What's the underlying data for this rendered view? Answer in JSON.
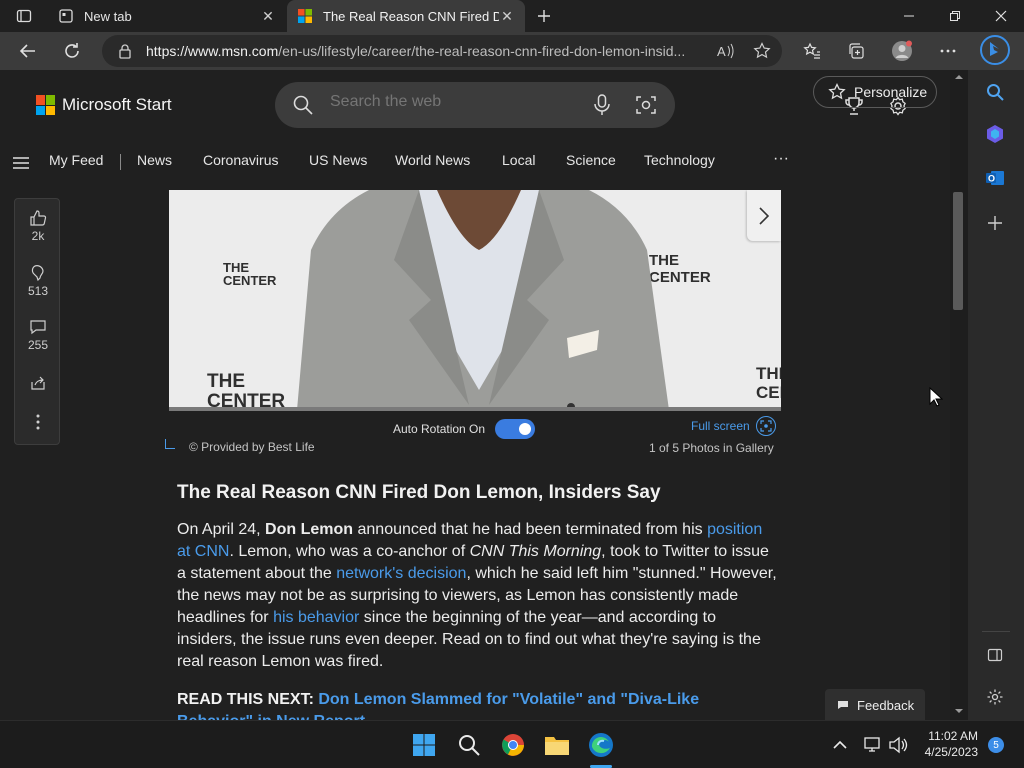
{
  "browser": {
    "tabs": [
      {
        "title": "New tab"
      },
      {
        "title": "The Real Reason CNN Fired Don"
      }
    ],
    "url_host": "https://www.msn.com",
    "url_path": "/en-us/lifestyle/career/the-real-reason-cnn-fired-don-lemon-insid..."
  },
  "site": {
    "logo_text": "Microsoft Start",
    "search_placeholder": "Search the web",
    "nav": [
      "My Feed",
      "News",
      "Coronavirus",
      "US News",
      "World News",
      "Local",
      "Science",
      "Technology"
    ],
    "more": "···",
    "personalize": "Personalize"
  },
  "engagement": {
    "likes": "2k",
    "dislikes": "513",
    "comments": "255"
  },
  "gallery": {
    "auto_rotation": "Auto Rotation On",
    "fullscreen": "Full screen",
    "credit": "© Provided by Best Life",
    "count": "1 of 5 Photos in Gallery",
    "backdrop_words": [
      "THE",
      "CENTER"
    ]
  },
  "article": {
    "title": "The Real Reason CNN Fired Don Lemon, Insiders Say",
    "body": {
      "p1": "On April 24, ",
      "name": "Don Lemon",
      "p2": " announced that he had been terminated from his ",
      "link1": "position at CNN",
      "p3": ". Lemon, who was a co-anchor of ",
      "show": "CNN This Morning",
      "p4": ", took to Twitter to issue a statement about the ",
      "link2": "network's decision",
      "p5": ", which he said left him \"stunned.\" However, the news may not be as surprising to viewers, as Lemon has consistently made headlines for ",
      "link3": "his behavior",
      "p6": " since the beginning of the year—and according to insiders, the issue runs even deeper. Read on to find out what they're saying is the real reason Lemon was fired."
    },
    "read_next_label": "READ THIS NEXT: ",
    "read_next_link": "Don Lemon Slammed for \"Volatile\" and \"Diva-Like Behavior\" in New Report"
  },
  "feedback": "Feedback",
  "taskbar": {
    "time": "11:02 AM",
    "date": "4/25/2023",
    "notifications": "5"
  },
  "colors": {
    "accent": "#4a9bea",
    "toggle": "#3a7ce0"
  }
}
